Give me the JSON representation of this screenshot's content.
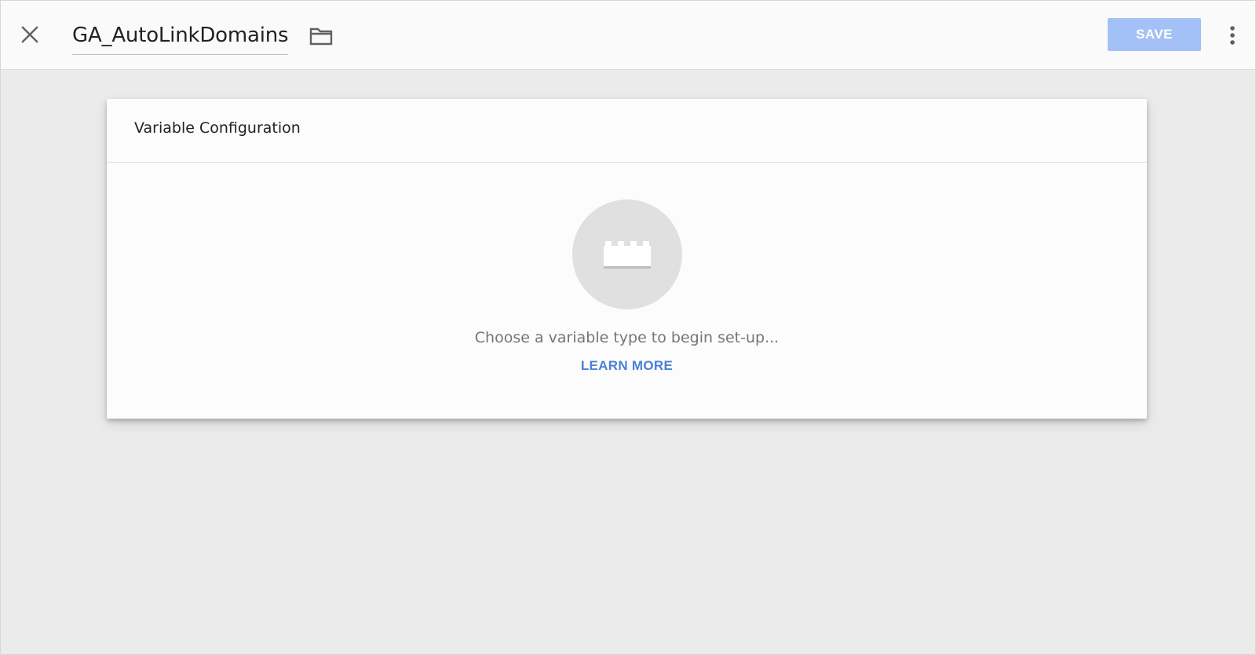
{
  "header": {
    "title": "GA_AutoLinkDomains",
    "save_label": "SAVE",
    "icons": {
      "close": "close-icon",
      "folder": "folder-icon",
      "more": "more-vert-icon"
    }
  },
  "card": {
    "title": "Variable Configuration",
    "prompt": "Choose a variable type to begin set-up...",
    "learn_more": "LEARN MORE",
    "icon": "lego-brick-icon"
  },
  "colors": {
    "page_background": "#ebebeb",
    "header_background": "#fafafa",
    "save_button": "#a3c1f6",
    "link": "#4a80d9",
    "icon_circle": "#e0e0e0"
  }
}
